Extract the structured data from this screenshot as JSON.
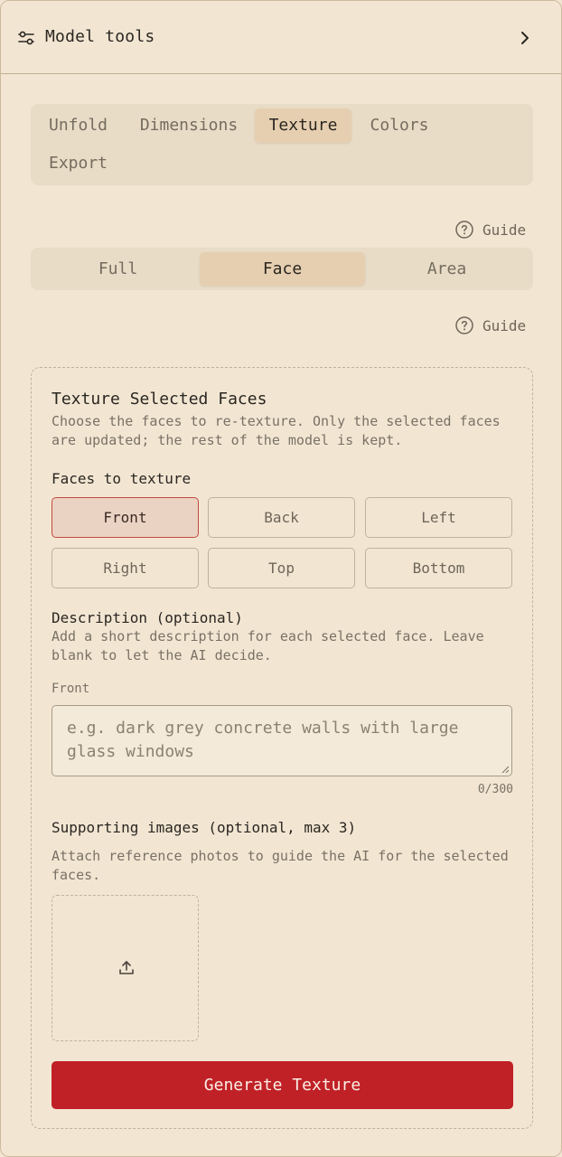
{
  "header": {
    "title": "Model tools",
    "icon": "sliders-icon",
    "chevron": "chevron-right-icon"
  },
  "tabs": [
    {
      "label": "Unfold",
      "active": false
    },
    {
      "label": "Dimensions",
      "active": false
    },
    {
      "label": "Texture",
      "active": true
    },
    {
      "label": "Colors",
      "active": false
    },
    {
      "label": "Export",
      "active": false
    }
  ],
  "guide_label": "Guide",
  "modes": [
    {
      "label": "Full",
      "active": false
    },
    {
      "label": "Face",
      "active": true
    },
    {
      "label": "Area",
      "active": false
    }
  ],
  "card": {
    "title": "Texture Selected Faces",
    "description": "Choose the faces to re-texture. Only the selected faces are updated; the rest of the model is kept.",
    "faces_label": "Faces to texture",
    "faces": [
      {
        "label": "Front",
        "selected": true
      },
      {
        "label": "Back",
        "selected": false
      },
      {
        "label": "Left",
        "selected": false
      },
      {
        "label": "Right",
        "selected": false
      },
      {
        "label": "Top",
        "selected": false
      },
      {
        "label": "Bottom",
        "selected": false
      }
    ],
    "desc_label": "Description (optional)",
    "desc_help": "Add a short description for each selected face. Leave blank to let the AI decide.",
    "field_label": "Front",
    "field_placeholder": "e.g. dark grey concrete walls with large glass windows",
    "field_value": "",
    "counter": "0/300",
    "images_label": "Supporting images (optional, max 3)",
    "images_help": "Attach reference photos to guide the AI for the selected faces.",
    "upload_icon": "upload-icon",
    "generate_label": "Generate Texture"
  },
  "colors": {
    "accent": "#c02126",
    "background": "#f2e6d3",
    "active_tab": "#e6cfb0"
  }
}
